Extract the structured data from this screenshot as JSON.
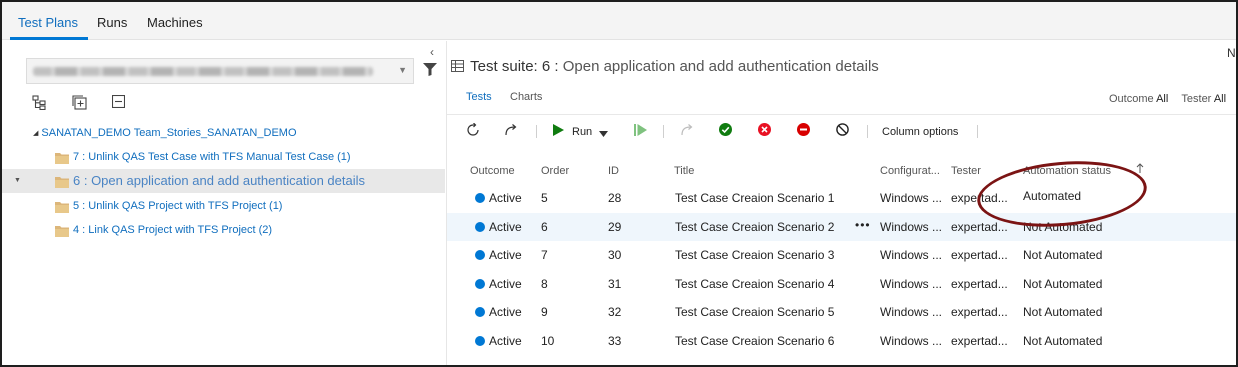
{
  "top_tabs": [
    {
      "label": "Test Plans",
      "active": true
    },
    {
      "label": "Runs",
      "active": false
    },
    {
      "label": "Machines",
      "active": false
    }
  ],
  "left": {
    "plan_selector_value": "",
    "tree": {
      "root": {
        "label": "SANATAN_DEMO Team_Stories_SANATAN_DEMO"
      },
      "suites": [
        {
          "label": "7 : Unlink QAS Test Case with TFS Manual Test Case (1)",
          "selected": false
        },
        {
          "label": "6 : Open application and add authentication details",
          "selected": true
        },
        {
          "label": "5 : Unlink QAS Project with TFS Project (1)",
          "selected": false
        },
        {
          "label": "4 : Link QAS Project with TFS Project (2)",
          "selected": false
        }
      ]
    }
  },
  "right": {
    "suite_title_prefix": "Test suite: 6 :",
    "suite_title_name": "Open application and add authentication details",
    "corner_text": "N",
    "subtabs": [
      {
        "label": "Tests",
        "active": true
      },
      {
        "label": "Charts",
        "active": false
      }
    ],
    "filters": {
      "outcome_label": "Outcome",
      "outcome_value": "All",
      "tester_label": "Tester",
      "tester_value": "All"
    },
    "toolbar": {
      "run_label": "Run",
      "column_options_label": "Column options"
    },
    "grid": {
      "columns": [
        "Outcome",
        "Order",
        "ID",
        "Title",
        "Configurat...",
        "Tester",
        "Automation status"
      ],
      "rows": [
        {
          "outcome": "Active",
          "order": "5",
          "id": "28",
          "title": "Test Case Creaion Scenario 1",
          "config": "Windows ...",
          "tester": "expertad...",
          "automation": "Automated"
        },
        {
          "outcome": "Active",
          "order": "6",
          "id": "29",
          "title": "Test Case Creaion Scenario 2",
          "config": "Windows ...",
          "tester": "expertad...",
          "automation": "Not Automated"
        },
        {
          "outcome": "Active",
          "order": "7",
          "id": "30",
          "title": "Test Case Creaion Scenario 3",
          "config": "Windows ...",
          "tester": "expertad...",
          "automation": "Not Automated"
        },
        {
          "outcome": "Active",
          "order": "8",
          "id": "31",
          "title": "Test Case Creaion Scenario 4",
          "config": "Windows ...",
          "tester": "expertad...",
          "automation": "Not Automated"
        },
        {
          "outcome": "Active",
          "order": "9",
          "id": "32",
          "title": "Test Case Creaion Scenario 5",
          "config": "Windows ...",
          "tester": "expertad...",
          "automation": "Not Automated"
        },
        {
          "outcome": "Active",
          "order": "10",
          "id": "33",
          "title": "Test Case Creaion Scenario 6",
          "config": "Windows ...",
          "tester": "expertad...",
          "automation": "Not Automated"
        }
      ]
    }
  },
  "colors": {
    "accent": "#0078d4",
    "pass": "#107c10",
    "fail": "#e81123",
    "blocked": "#d80000",
    "annotation": "#7b1414"
  }
}
